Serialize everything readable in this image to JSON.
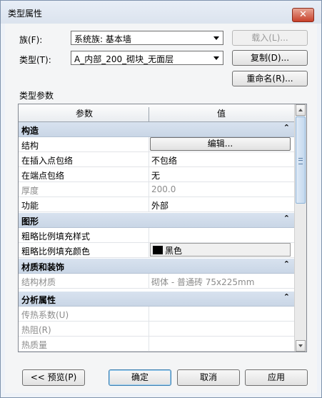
{
  "window": {
    "title": "类型属性",
    "close_symbol": "✕"
  },
  "family": {
    "label": "族(F):",
    "value": "系统族: 基本墙",
    "load_label": "载入(L)..."
  },
  "type": {
    "label": "类型(T):",
    "value": "A_内部_200_砌块_无面层",
    "duplicate_label": "复制(D)...",
    "rename_label": "重命名(R)..."
  },
  "section_label": "类型参数",
  "grid": {
    "columns": [
      "参数",
      "值"
    ],
    "collapse_symbol": "⌃",
    "groups": [
      {
        "title": "构造",
        "rows": [
          {
            "param": "结构",
            "value": "编辑..."
          },
          {
            "param": "在插入点包络",
            "value": "不包络"
          },
          {
            "param": "在端点包络",
            "value": "无"
          },
          {
            "param": "厚度",
            "value": "200.0"
          },
          {
            "param": "功能",
            "value": "外部"
          }
        ]
      },
      {
        "title": "图形",
        "rows": [
          {
            "param": "粗略比例填充样式",
            "value": ""
          },
          {
            "param": "粗略比例填充颜色",
            "value": "黑色"
          }
        ]
      },
      {
        "title": "材质和装饰",
        "rows": [
          {
            "param": "结构材质",
            "value": "砌体 - 普通砖 75x225mm"
          }
        ]
      },
      {
        "title": "分析属性",
        "rows": [
          {
            "param": "传热系数(U)",
            "value": ""
          },
          {
            "param": "热阻(R)",
            "value": ""
          },
          {
            "param": "热质量",
            "value": ""
          }
        ]
      }
    ]
  },
  "footer": {
    "preview_label": "<< 预览(P)",
    "ok_label": "确定",
    "cancel_label": "取消",
    "apply_label": "应用"
  },
  "colors": {
    "swatch": "#000000",
    "group_header": "#cfdbea",
    "close_button": "#c7402a"
  }
}
